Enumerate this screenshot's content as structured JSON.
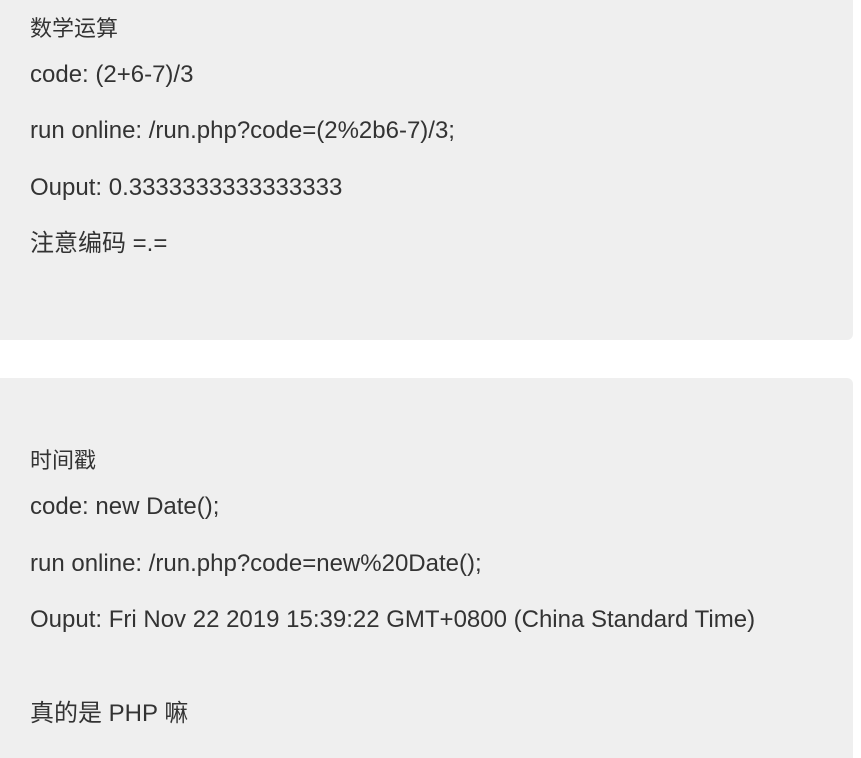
{
  "sections": [
    {
      "title": "数学运算",
      "code_label": "code:",
      "code_value": "(2+6-7)/3",
      "run_label": "run online:",
      "run_value": "/run.php?code=(2%2b6-7)/3;",
      "output_label": "Ouput:",
      "output_value": "0.3333333333333333",
      "note": "注意编码 =.="
    },
    {
      "title": "时间戳",
      "code_label": "code:",
      "code_value": "new Date();",
      "run_label": "run online:",
      "run_value": "/run.php?code=new%20Date();",
      "output_label": "Ouput:",
      "output_value": "Fri Nov 22 2019 15:39:22 GMT+0800 (China Standard Time)",
      "note": "真的是 PHP 嘛"
    }
  ]
}
